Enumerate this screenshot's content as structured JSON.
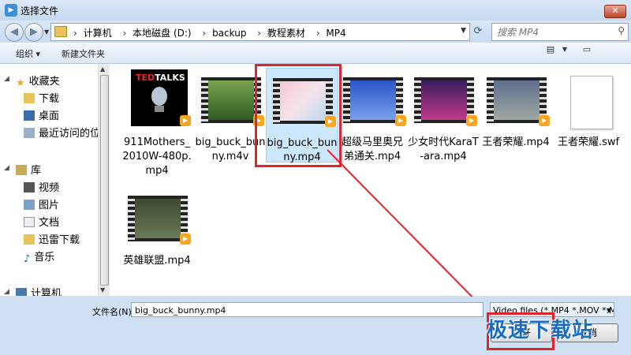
{
  "window": {
    "title": "选择文件"
  },
  "address": {
    "crumbs": [
      "计算机",
      "本地磁盘 (D:)",
      "backup",
      "教程素材",
      "MP4"
    ]
  },
  "search": {
    "placeholder": "搜索 MP4"
  },
  "toolbar": {
    "organize": "组织 ▾",
    "new_folder": "新建文件夹"
  },
  "sidebar": {
    "favorites_head": "收藏夹",
    "favorites": [
      "下载",
      "桌面",
      "最近访问的位"
    ],
    "library_head": "库",
    "library": [
      "视频",
      "图片",
      "文档",
      "迅雷下载",
      "音乐"
    ],
    "computer_head": "计算机"
  },
  "files": [
    {
      "name": "911Mothers_2010W-480p.mp4",
      "icon": "video-thumbnail-icon"
    },
    {
      "name": "big_buck_bunny.m4v",
      "icon": "video-thumbnail-icon"
    },
    {
      "name": "big_buck_bunny.mp4",
      "icon": "video-thumbnail-icon",
      "selected": true
    },
    {
      "name": "超级马里奥兄弟通关.mp4",
      "icon": "video-thumbnail-icon"
    },
    {
      "name": "少女时代KaraT-ara.mp4",
      "icon": "video-thumbnail-icon"
    },
    {
      "name": "王者荣耀.mp4",
      "icon": "video-thumbnail-icon"
    },
    {
      "name": "王者荣耀.swf",
      "icon": "swf-file-icon"
    },
    {
      "name": "英雄联盟.mp4",
      "icon": "video-thumbnail-icon"
    }
  ],
  "bottom": {
    "filename_label": "文件名(N):",
    "filename_value": "big_buck_bunny.mp4",
    "filter_value": "Video files (*.MP4 *.MOV *.M",
    "open_button": "打开",
    "cancel_button": "取消"
  },
  "watermark": "极速下载站",
  "colors": {
    "highlight": "#e0252a",
    "selection": "#cce8ff",
    "chrome": "#cfe0f3"
  }
}
